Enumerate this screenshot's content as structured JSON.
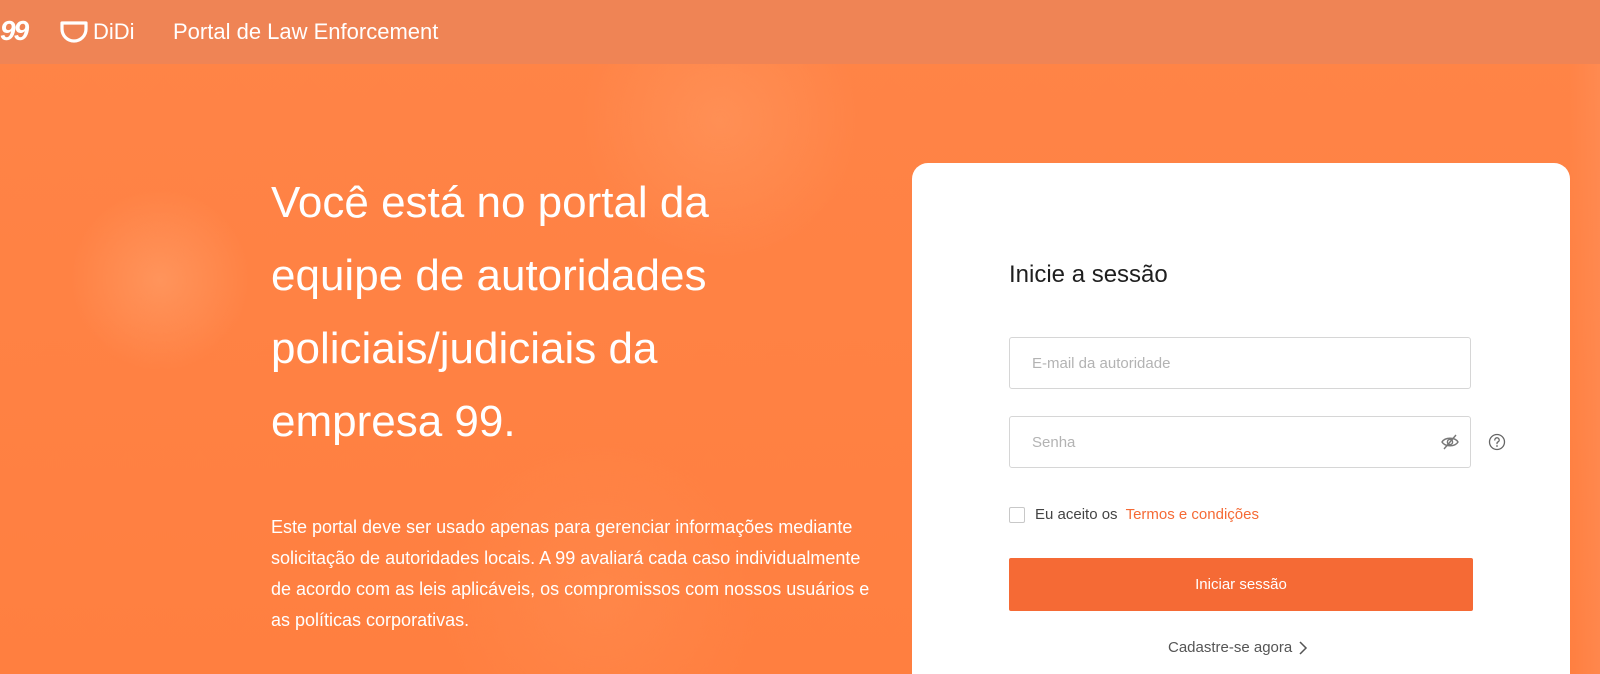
{
  "header": {
    "logo_99": "99",
    "didi_label": "DiDi",
    "portal_title": "Portal de Law Enforcement"
  },
  "hero": {
    "headline": "Você está no portal da equipe de autoridades policiais/judiciais da empresa 99.",
    "description": "Este portal deve ser usado apenas para gerenciar informações mediante solicitação de autoridades locais. A 99 avaliará cada caso individualmente de acordo com as leis aplicáveis, os compromissos com nossos usuários e as políticas corporativas."
  },
  "login": {
    "title": "Inicie a sessão",
    "email_placeholder": "E-mail da autoridade",
    "email_value": "",
    "password_placeholder": "Senha",
    "password_value": "",
    "terms_prefix": "Eu aceito os",
    "terms_link": "Termos e condições",
    "terms_checked": false,
    "submit_label": "Iniciar sessão",
    "register_label": "Cadastre-se agora"
  },
  "icons": {
    "eye": "eye-slash-icon",
    "help": "question-circle-icon",
    "chevron": "chevron-right-icon"
  },
  "colors": {
    "header_bg": "#ef8455",
    "page_bg": "#ff8447",
    "accent": "#f56a35",
    "card_bg": "#ffffff"
  }
}
